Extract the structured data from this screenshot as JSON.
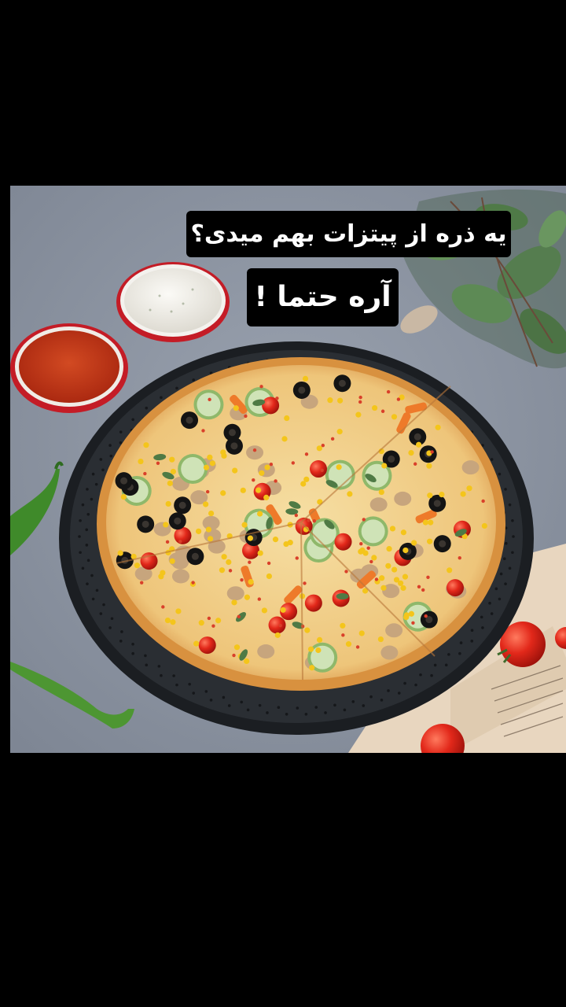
{
  "captions": {
    "question": "یه ذره از پیتزات بهم میدی؟",
    "answer": "آره حتما !"
  },
  "photo": {
    "subject": "vegetable-pizza"
  },
  "colors": {
    "letterbox": "#000000",
    "table": "#8a92a0",
    "caption_bg": "#000000",
    "caption_text": "#ffffff",
    "sauce": "#c83a1c",
    "dip": "#f1efe9",
    "bowl_rim": "#d81e2a",
    "tray": "#1f2226",
    "crust": "#e0a25a",
    "cheese": "#f3d592",
    "olive": "#141414",
    "tomato": "#d8341f",
    "corn": "#f4c51b",
    "zucchini": "#cfe3b7",
    "pepper": "#3f8a2a",
    "leaf": "#4f7a45"
  }
}
